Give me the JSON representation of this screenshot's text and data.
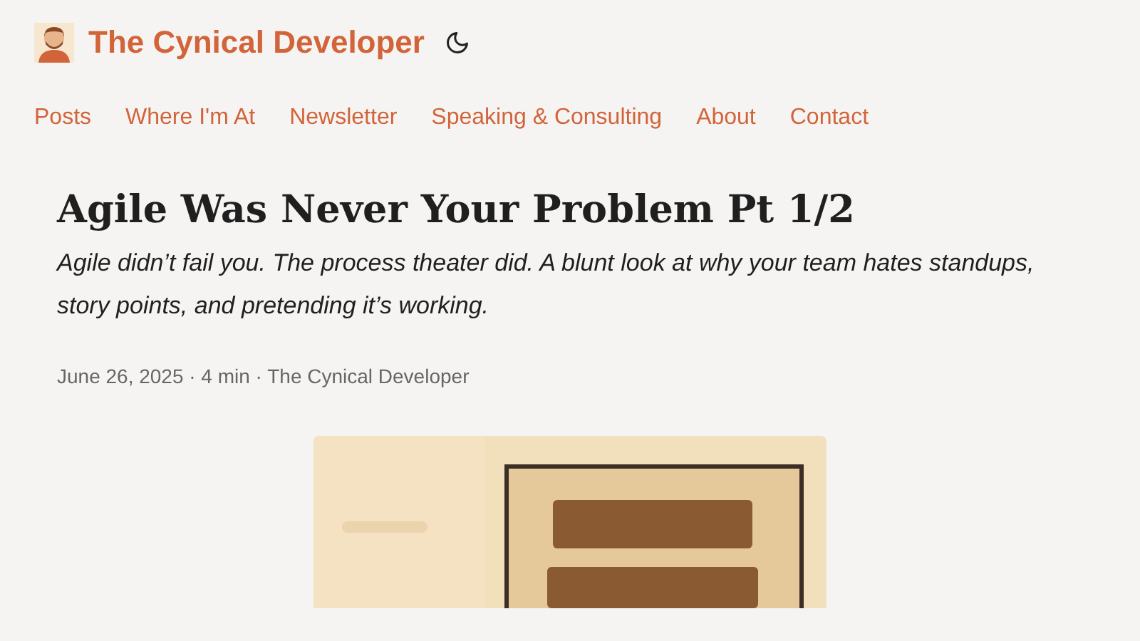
{
  "site": {
    "title": "The Cynical Developer"
  },
  "nav": [
    {
      "label": "Posts"
    },
    {
      "label": "Where I'm At"
    },
    {
      "label": "Newsletter"
    },
    {
      "label": "Speaking & Consulting"
    },
    {
      "label": "About"
    },
    {
      "label": "Contact"
    }
  ],
  "post": {
    "title": "Agile Was Never Your Problem Pt 1/2",
    "description": "Agile didn’t fail you. The process theater did. A blunt look at why your team hates standups, story points, and pretending it’s working.",
    "meta": "June 26, 2025 · 4 min · The Cynical Developer"
  }
}
